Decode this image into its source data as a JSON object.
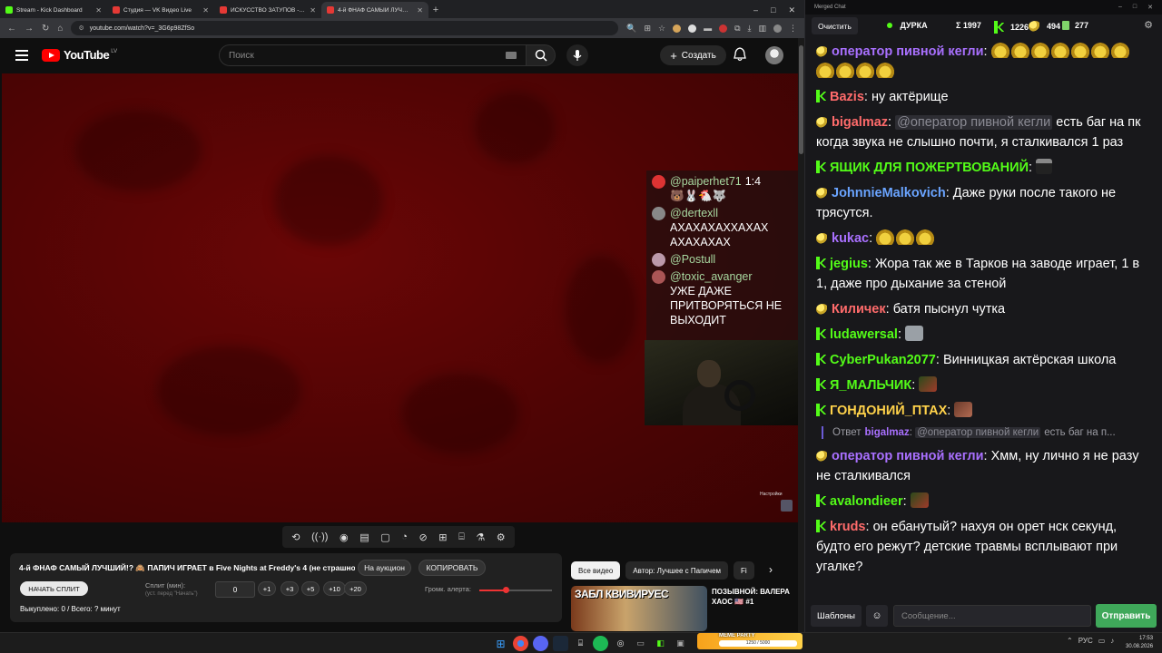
{
  "browser": {
    "tabs": [
      {
        "title": "Stream - Kick Dashboard",
        "color": "#53fc18"
      },
      {
        "title": "Студия — VK Видео Live",
        "color": "#e53935"
      },
      {
        "title": "ИСКУССТВО ЗАТУПОВ - YouTube",
        "color": "#e53935"
      },
      {
        "title": "4-й ФНАФ САМЫЙ ЛУЧШИЙ",
        "color": "#e53935"
      }
    ],
    "url": "youtube.com/watch?v=_3G6p98ZfSo"
  },
  "youtube": {
    "logo_text": "YouTube",
    "country": "LV",
    "search_placeholder": "Поиск",
    "create_label": "Создать"
  },
  "overlay_chat": [
    {
      "name": "@paiperhet71",
      "text": "🐻🐰🐔🐺",
      "suffix": "1:4",
      "avatar_color": "#d33"
    },
    {
      "name": "@dertexll",
      "text": "АХАХАХАХХАХАХ АХАХАХАХ",
      "suffix": "",
      "avatar_color": "#888"
    },
    {
      "name": "@Postull",
      "text": "",
      "suffix": "",
      "avatar_color": "#b9a"
    },
    {
      "name": "@toxic_avanger",
      "text": "УЖЕ ДАЖЕ ПРИТВОРЯТЬСЯ НЕ ВЫХОДИТ",
      "suffix": "",
      "avatar_color": "#a55"
    }
  ],
  "video": {
    "settings_label": "Настройки"
  },
  "split_panel": {
    "title": "4-й ФНАФ САМЫЙ ЛУЧШИЙ!? 🙈 ПАПИЧ ИГРАЕТ в Five Nights at Freddy's 4 (не страшно)",
    "auction_label": "На аукцион",
    "copy_label": "КОПИРОВАТЬ",
    "start_label": "НАЧАТЬ СПЛИТ",
    "split_label": "Сплит (мин):",
    "split_hint": "(уст. перед \"Начать\")",
    "split_value": "0",
    "increments": [
      "+1",
      "+3",
      "+5",
      "+10",
      "+20"
    ],
    "volume_label": "Громк. алерта:",
    "volume_level": 0.36,
    "bought_text": "Выкуплено: 0 / Всего: ? минут"
  },
  "recommendations": {
    "chips": [
      {
        "label": "Все видео",
        "selected": true
      },
      {
        "label": "Автор: Лучшее с Папичем",
        "selected": false
      },
      {
        "label": "Fi",
        "selected": false
      }
    ],
    "thumb_text": "ЗАБЛ КВИВИРУЕС",
    "video_title": "ПОЗЫВНОЙ: ВАЛЕРА ХАОС 🇺🇸 #1"
  },
  "chat": {
    "window_title": "Merged Chat",
    "clear_label": "Очистить",
    "channel": "ДУРКА",
    "total": "Σ 1997",
    "kick_count": "1226",
    "twitch_count": "494",
    "other_count": "277",
    "messages": [
      {
        "badge": "twitch",
        "user": "оператор пивной кегли",
        "color": "#a970ff",
        "mention": "",
        "text": "",
        "emotes": [
          "pepe",
          "pepe",
          "pepe",
          "pepe",
          "pepe",
          "pepe",
          "pepe",
          "pepe",
          "pepe",
          "pepe",
          "pepe"
        ]
      },
      {
        "badge": "kick",
        "user": "Bazis",
        "color": "#ff6b6b",
        "mention": "",
        "text": "ну актёрище",
        "emotes": []
      },
      {
        "badge": "twitch",
        "user": "bigalmaz",
        "color": "#ff6b6b",
        "mention": "@оператор пивной кегли",
        "text": "есть баг на пк когда звука не слышно почти, я сталкивался 1 раз",
        "emotes": []
      },
      {
        "badge": "kick",
        "user": "ЯЩИК ДЛЯ ПОЖЕРТВОВАНИЙ",
        "color": "#53fc18",
        "mention": "",
        "text": "",
        "emotes": [
          "hat"
        ]
      },
      {
        "badge": "twitch",
        "user": "JohnnieMalkovich",
        "color": "#6aa4ff",
        "mention": "",
        "text": "Даже руки после такого не трясутся.",
        "emotes": []
      },
      {
        "badge": "twitch",
        "user": "kukac",
        "color": "#a970ff",
        "mention": "",
        "text": "",
        "emotes": [
          "pepe",
          "pepe",
          "pepe"
        ]
      },
      {
        "badge": "kick",
        "user": "jegius",
        "color": "#53fc18",
        "mention": "",
        "text": "Жора так же в Тарков на заводе играет, 1 в 1, даже про дыхание за стеной",
        "emotes": []
      },
      {
        "badge": "twitch",
        "user": "Киличек",
        "color": "#ff6b6b",
        "mention": "",
        "text": "батя пыснул чутка",
        "emotes": []
      },
      {
        "badge": "kick",
        "user": "ludawersal",
        "color": "#53fc18",
        "mention": "",
        "text": "",
        "emotes": [
          "grey"
        ]
      },
      {
        "badge": "kick",
        "user": "CyberPukan2077",
        "color": "#53fc18",
        "mention": "",
        "text": "Винницкая актёрская школа",
        "emotes": []
      },
      {
        "badge": "kick",
        "user": "Я_МАЛЬЧИК",
        "color": "#53fc18",
        "mention": "",
        "text": "",
        "emotes": [
          "green"
        ]
      },
      {
        "badge": "kick",
        "user": "ГОНДОНИЙ_ПТАХ",
        "color": "#ffd24a",
        "mention": "",
        "text": "",
        "emotes": [
          "brown"
        ]
      },
      {
        "badge": "reply",
        "user": "bigalmaz",
        "color": "#a970ff",
        "mention": "@оператор пивной кегли",
        "text": "есть баг на п...",
        "emotes": []
      },
      {
        "badge": "twitch",
        "user": "оператор пивной кегли",
        "color": "#a970ff",
        "mention": "",
        "text": "Хмм, ну лично я не разу не сталкивался",
        "emotes": []
      },
      {
        "badge": "kick",
        "user": "avalondieer",
        "color": "#53fc18",
        "mention": "",
        "text": "",
        "emotes": [
          "green"
        ]
      },
      {
        "badge": "kick",
        "user": "kruds",
        "color": "#ff6b6b",
        "mention": "",
        "text": "он ебанутый? нахуя он орет нск секунд, будто его режут? детские травмы всплывают при угалке?",
        "emotes": []
      }
    ],
    "reply_prefix": "Ответ",
    "templates_label": "Шаблоны",
    "input_placeholder": "Сообщение...",
    "send_label": "Отправить"
  },
  "taskbar": {
    "widget_label": "MEME PARTY",
    "widget_progress": "1250 / 5000",
    "lang": "РУС",
    "time": "17:53",
    "date": "30.08.2026"
  }
}
